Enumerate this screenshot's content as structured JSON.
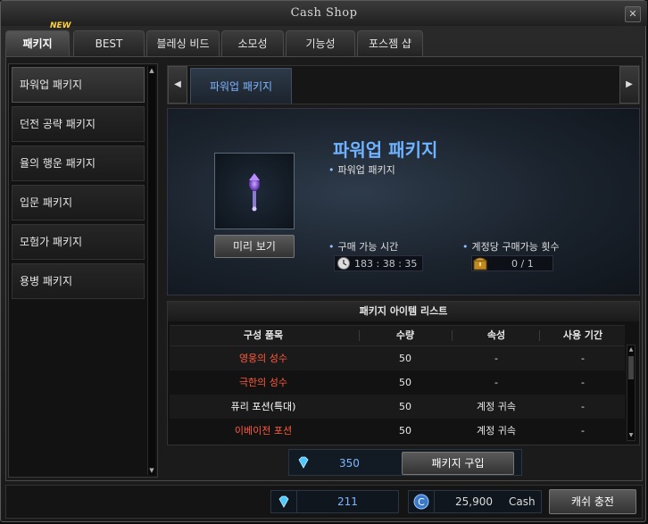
{
  "window": {
    "title": "Cash Shop",
    "close_label": "✕"
  },
  "tabs": [
    {
      "label": "패키지",
      "active": true,
      "badge": "NEW"
    },
    {
      "label": "BEST"
    },
    {
      "label": "블레싱 비드"
    },
    {
      "label": "소모성"
    },
    {
      "label": "기능성"
    },
    {
      "label": "포스젬 샵"
    }
  ],
  "sidebar": {
    "items": [
      {
        "label": "파워업 패키지"
      },
      {
        "label": "던전 공략 패키지"
      },
      {
        "label": "율의 행운 패키지"
      },
      {
        "label": "입문 패키지"
      },
      {
        "label": "모험가 패키지"
      },
      {
        "label": "용병 패키지"
      }
    ]
  },
  "package_tabs": {
    "current": "파워업 패키지"
  },
  "detail": {
    "name": "파워업 패키지",
    "subtitle": "파워업 패키지",
    "preview_label": "미리 보기",
    "time_label": "구매 가능 시간",
    "time_value": "183 : 38 : 35",
    "count_label": "계정당 구매가능 횟수",
    "count_value": "0 / 1"
  },
  "item_list": {
    "title": "패키지 아이템 리스트",
    "headers": [
      "구성 품목",
      "수량",
      "속성",
      "사용 기간"
    ],
    "rows": [
      {
        "name": "영웅의 성수",
        "qty": "50",
        "attr": "-",
        "period": "-",
        "color": "#ff5a3c"
      },
      {
        "name": "극한의 성수",
        "qty": "50",
        "attr": "-",
        "period": "-",
        "color": "#ff5a3c"
      },
      {
        "name": "퓨리 포션(특대)",
        "qty": "50",
        "attr": "계정 귀속",
        "period": "-",
        "color": "#ffffff"
      },
      {
        "name": "이베이전 포션",
        "qty": "50",
        "attr": "계정 귀속",
        "period": "-",
        "color": "#ff5a3c"
      }
    ]
  },
  "purchase": {
    "price": "350",
    "buy_label": "패키지 구입"
  },
  "wallet": {
    "gems": "211",
    "cash": "25,900",
    "cash_unit": "Cash",
    "charge_label": "캐쉬 충전"
  },
  "colors": {
    "accent": "#6fb2ff",
    "highlight_item": "#ff5a3c",
    "gem": "#4fc8ff"
  }
}
